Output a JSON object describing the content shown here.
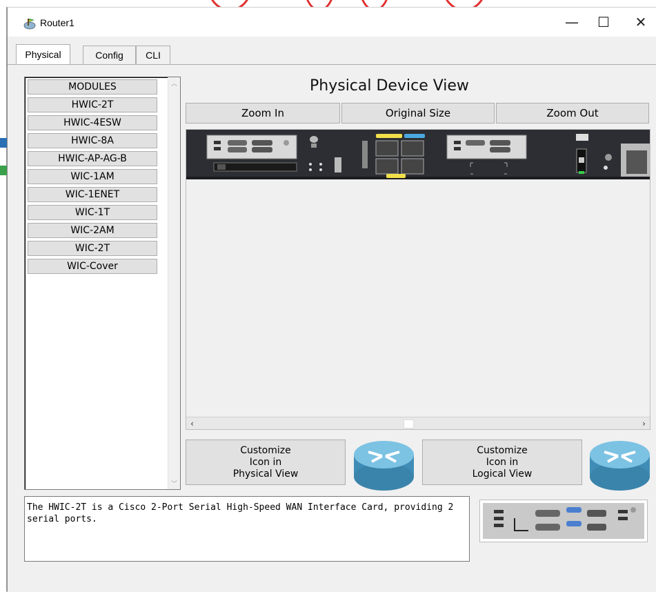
{
  "window": {
    "title": "Router1",
    "controls": {
      "minimize": "—",
      "maximize": "☐",
      "close": "✕"
    }
  },
  "tabs": [
    {
      "label": "Physical",
      "active": true
    },
    {
      "label": "Config",
      "active": false
    },
    {
      "label": "CLI",
      "active": false
    }
  ],
  "modules": {
    "header": "MODULES",
    "items": [
      "HWIC-2T",
      "HWIC-4ESW",
      "HWIC-8A",
      "HWIC-AP-AG-B",
      "WIC-1AM",
      "WIC-1ENET",
      "WIC-1T",
      "WIC-2AM",
      "WIC-2T",
      "WIC-Cover"
    ]
  },
  "physical_view": {
    "title": "Physical Device View",
    "zoom_in": "Zoom In",
    "original_size": "Original Size",
    "zoom_out": "Zoom Out"
  },
  "customize": {
    "physical": {
      "line1": "Customize",
      "line2": "Icon in",
      "line3": "Physical View"
    },
    "logical": {
      "line1": "Customize",
      "line2": "Icon in",
      "line3": "Logical View"
    }
  },
  "description": "The HWIC-2T is a Cisco 2-Port Serial High-Speed WAN Interface Card, providing 2 serial ports.",
  "colors": {
    "chassis": "#2c2e33",
    "router_icon": "#4d9cc4",
    "button_face": "#e1e1e1"
  }
}
